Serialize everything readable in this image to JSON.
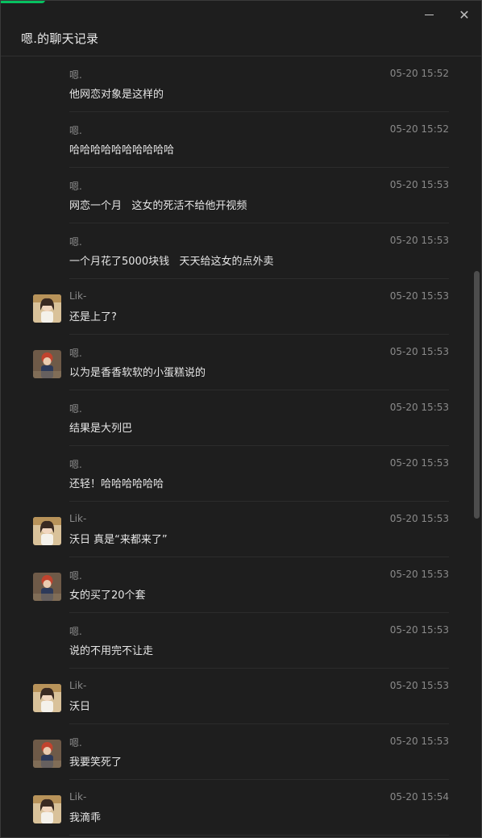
{
  "window": {
    "title": "嗯.的聊天记录",
    "accent_color": "#07c160",
    "minimize_icon": "minimize-icon",
    "close_icon": "close-icon",
    "close_glyph": "✕"
  },
  "messages": [
    {
      "sender": "嗯.",
      "time": "05-20 15:52",
      "text": "他网恋对象是这样的",
      "avatar": null
    },
    {
      "sender": "嗯.",
      "time": "05-20 15:52",
      "text": "哈哈哈哈哈哈哈哈哈哈",
      "avatar": null
    },
    {
      "sender": "嗯.",
      "time": "05-20 15:53",
      "text": "网恋一个月   这女的死活不给他开视频",
      "avatar": null
    },
    {
      "sender": "嗯.",
      "time": "05-20 15:53",
      "text": "一个月花了5000块钱   天天给这女的点外卖",
      "avatar": null
    },
    {
      "sender": "Lik-",
      "time": "05-20 15:53",
      "text": "还是上了?",
      "avatar": "lik"
    },
    {
      "sender": "嗯.",
      "time": "05-20 15:53",
      "text": "以为是香香软软的小蛋糕说的",
      "avatar": "en"
    },
    {
      "sender": "嗯.",
      "time": "05-20 15:53",
      "text": "结果是大列巴",
      "avatar": null
    },
    {
      "sender": "嗯.",
      "time": "05-20 15:53",
      "text": "还轻！哈哈哈哈哈哈",
      "avatar": null
    },
    {
      "sender": "Lik-",
      "time": "05-20 15:53",
      "text": "沃日 真是“来都来了”",
      "avatar": "lik"
    },
    {
      "sender": "嗯.",
      "time": "05-20 15:53",
      "text": "女的买了20个套",
      "avatar": "en"
    },
    {
      "sender": "嗯.",
      "time": "05-20 15:53",
      "text": "说的不用完不让走",
      "avatar": null
    },
    {
      "sender": "Lik-",
      "time": "05-20 15:53",
      "text": "沃日",
      "avatar": "lik"
    },
    {
      "sender": "嗯.",
      "time": "05-20 15:53",
      "text": "我要笑死了",
      "avatar": "en"
    },
    {
      "sender": "Lik-",
      "time": "05-20 15:54",
      "text": "我滴乖",
      "avatar": "lik"
    }
  ]
}
